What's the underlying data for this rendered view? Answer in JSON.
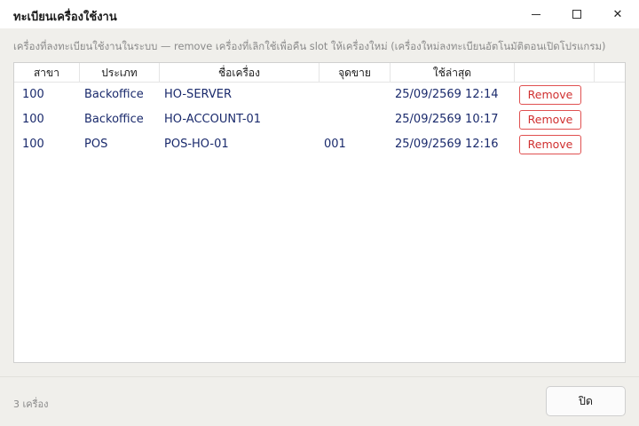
{
  "window": {
    "title": "ทะเบียนเครื่องใช้งาน",
    "minimize_glyph": "",
    "close_glyph": "✕"
  },
  "instruction": "เครื่องที่ลงทะเบียนใช้งานในระบบ — remove เครื่องที่เลิกใช้เพื่อคืน slot ให้เครื่องใหม่ (เครื่องใหม่ลงทะเบียนอัตโนมัติตอนเปิดโปรแกรม)",
  "table": {
    "headers": [
      "สาขา",
      "ประเภท",
      "ชื่อเครื่อง",
      "จุดขาย",
      "ใช้ล่าสุด",
      ""
    ],
    "rows": [
      {
        "branch": "100",
        "type": "Backoffice",
        "name": "HO-SERVER",
        "pos": "",
        "last_used": "25/09/2569 12:14",
        "action": "Remove"
      },
      {
        "branch": "100",
        "type": "Backoffice",
        "name": "HO-ACCOUNT-01",
        "pos": "",
        "last_used": "25/09/2569 10:17",
        "action": "Remove"
      },
      {
        "branch": "100",
        "type": "POS",
        "name": "POS-HO-01",
        "pos": "001",
        "last_used": "25/09/2569 12:16",
        "action": "Remove"
      }
    ]
  },
  "footer": {
    "count_label": "3 เครื่อง",
    "close_label": "ปิด"
  },
  "colors": {
    "accent_remove": "#d03030",
    "row_text": "#1a2a6c",
    "window_bg": "#f0efeb"
  }
}
